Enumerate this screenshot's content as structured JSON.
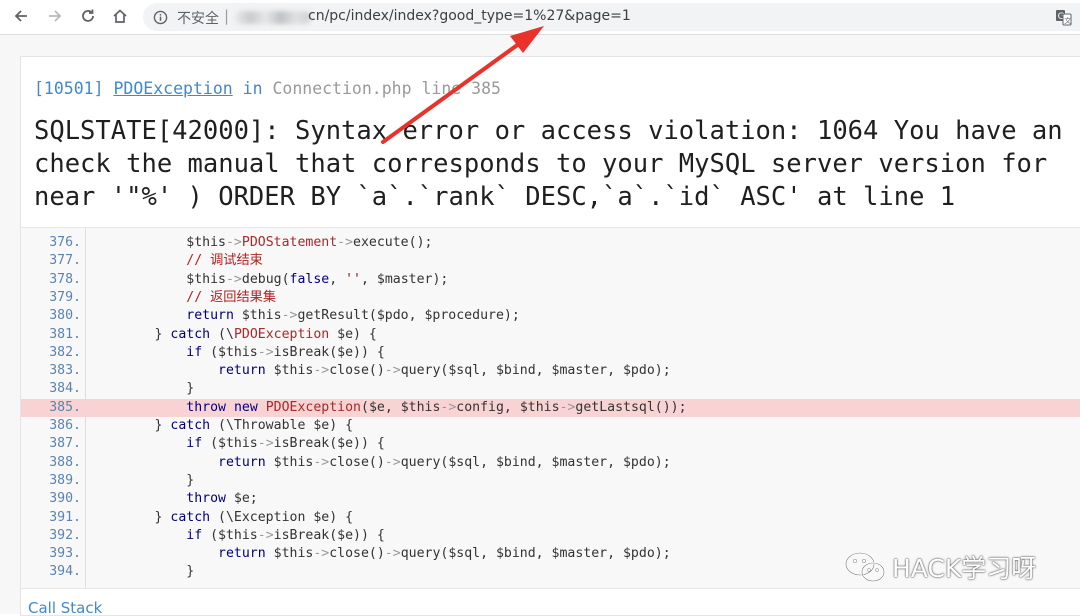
{
  "browser": {
    "security_label": "不安全",
    "separator": "|",
    "url_visible": "cn/pc/index/index?good_type=1%27&page=1",
    "icons": [
      "back-icon",
      "forward-icon",
      "reload-icon",
      "home-icon",
      "info-icon",
      "translate-icon"
    ]
  },
  "error": {
    "code": "[10501]",
    "exception_class": "PDOException",
    "in_word": "in",
    "location": "Connection.php line 385",
    "message_lines": [
      "SQLSTATE[42000]: Syntax error or access violation: 1064 You have an",
      "check the manual that corresponds to your MySQL server version for",
      "near '\"%' ) ORDER BY `a`.`rank` DESC,`a`.`id` ASC' at line 1"
    ]
  },
  "source": {
    "highlight_line": "385.",
    "lines": [
      {
        "num": "376.",
        "code": "            $this->PDOStatement->execute();"
      },
      {
        "num": "377.",
        "code": "            // 调试结束"
      },
      {
        "num": "378.",
        "code": "            $this->debug(false, '', $master);"
      },
      {
        "num": "379.",
        "code": "            // 返回结果集"
      },
      {
        "num": "380.",
        "code": "            return $this->getResult($pdo, $procedure);"
      },
      {
        "num": "381.",
        "code": "        } catch (\\PDOException $e) {"
      },
      {
        "num": "382.",
        "code": "            if ($this->isBreak($e)) {"
      },
      {
        "num": "383.",
        "code": "                return $this->close()->query($sql, $bind, $master, $pdo);"
      },
      {
        "num": "384.",
        "code": "            }"
      },
      {
        "num": "385.",
        "code": "            throw new PDOException($e, $this->config, $this->getLastsql());"
      },
      {
        "num": "386.",
        "code": "        } catch (\\Throwable $e) {"
      },
      {
        "num": "387.",
        "code": "            if ($this->isBreak($e)) {"
      },
      {
        "num": "388.",
        "code": "                return $this->close()->query($sql, $bind, $master, $pdo);"
      },
      {
        "num": "389.",
        "code": "            }"
      },
      {
        "num": "390.",
        "code": "            throw $e;"
      },
      {
        "num": "391.",
        "code": "        } catch (\\Exception $e) {"
      },
      {
        "num": "392.",
        "code": "            if ($this->isBreak($e)) {"
      },
      {
        "num": "393.",
        "code": "                return $this->close()->query($sql, $bind, $master, $pdo);"
      },
      {
        "num": "394.",
        "code": "            }"
      }
    ]
  },
  "call_stack_label": "Call Stack",
  "watermark": {
    "text": "HACK学习呀",
    "icon": "wechat-icon"
  },
  "colors": {
    "accent": "#4288ce",
    "highlight_row": "#f9d3d3",
    "annotation_arrow": "#e8322a"
  }
}
